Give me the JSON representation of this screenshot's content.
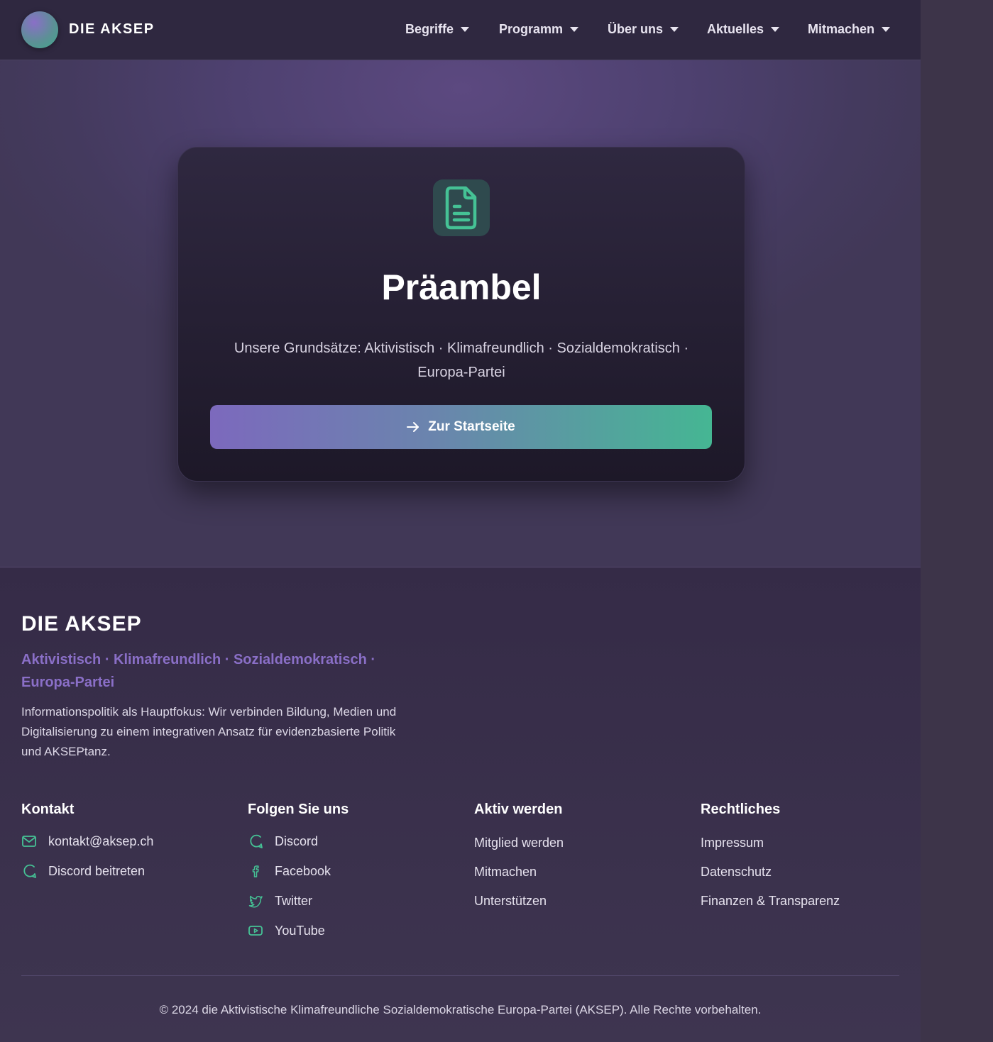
{
  "nav": {
    "brand": "DIE AKSEP",
    "items": [
      {
        "label": "Begriffe"
      },
      {
        "label": "Programm"
      },
      {
        "label": "Über uns"
      },
      {
        "label": "Aktuelles"
      },
      {
        "label": "Mitmachen"
      }
    ]
  },
  "hero": {
    "icon": "document-icon",
    "title": "Präambel",
    "subtitle": "Unsere Grundsätze: Aktivistisch · Klimafreundlich · Sozialdemokratisch · Europa-Partei",
    "button_label": "Zur Startseite",
    "button_icon": "arrow-right-icon"
  },
  "footer": {
    "brand": "DIE AKSEP",
    "tagline": "Aktivistisch · Klimafreundlich · Sozialdemokratisch · Europa-Partei",
    "description": "Informationspolitik als Hauptfokus: Wir verbinden Bildung, Medien und Digitalisierung zu einem integrativen Ansatz für evidenzbasierte Politik und AKSEPtanz.",
    "columns": {
      "kontakt": {
        "title": "Kontakt",
        "links": [
          {
            "label": "kontakt@aksep.ch",
            "icon": "mail-icon"
          },
          {
            "label": "Discord beitreten",
            "icon": "discord-icon"
          }
        ]
      },
      "social": {
        "title": "Folgen Sie uns",
        "links": [
          {
            "label": "Discord",
            "icon": "discord-icon"
          },
          {
            "label": "Facebook",
            "icon": "facebook-icon"
          },
          {
            "label": "Twitter",
            "icon": "twitter-icon"
          },
          {
            "label": "YouTube",
            "icon": "youtube-icon"
          }
        ]
      },
      "aktiv": {
        "title": "Aktiv werden",
        "links": [
          {
            "label": "Mitglied werden"
          },
          {
            "label": "Mitmachen"
          },
          {
            "label": "Unterstützen"
          }
        ]
      },
      "recht": {
        "title": "Rechtliches",
        "links": [
          {
            "label": "Impressum"
          },
          {
            "label": "Datenschutz"
          },
          {
            "label": "Finanzen & Transparenz"
          }
        ]
      }
    },
    "copyright": "© 2024 die Aktivistische Klimafreundliche Sozialdemokratische Europa-Partei (AKSEP). Alle Rechte vorbehalten."
  },
  "colors": {
    "accent_purple": "#8a6fc7",
    "accent_green": "#45b693",
    "background": "#3d3449"
  }
}
